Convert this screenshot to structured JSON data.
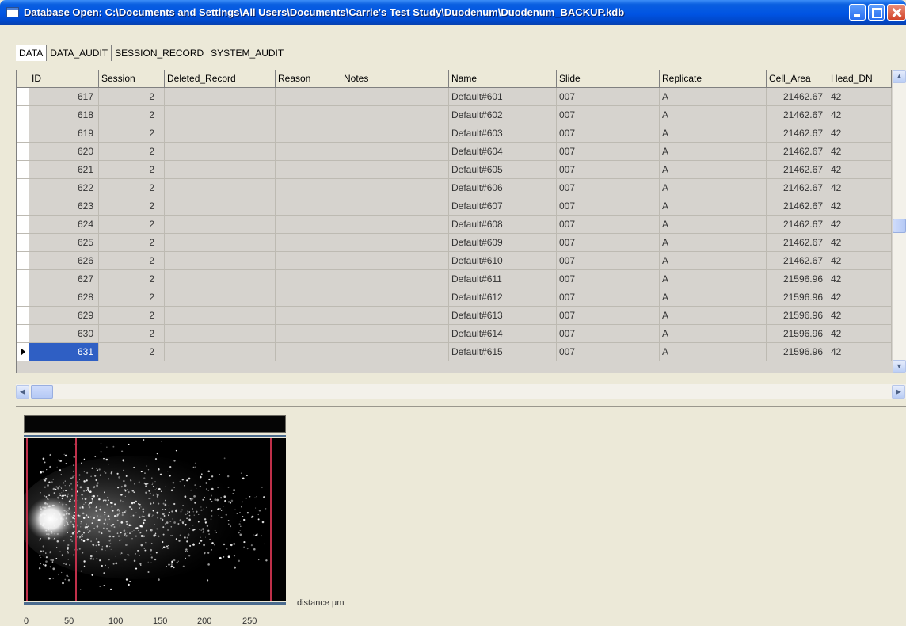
{
  "window": {
    "title": "Database Open: C:\\Documents and Settings\\All Users\\Documents\\Carrie's Test Study\\Duodenum\\Duodenum_BACKUP.kdb"
  },
  "tabs": [
    "DATA",
    "DATA_AUDIT",
    "SESSION_RECORD",
    "SYSTEM_AUDIT"
  ],
  "grid": {
    "columns": [
      "ID",
      "Session",
      "Deleted_Record",
      "Reason",
      "Notes",
      "Name",
      "Slide",
      "Replicate",
      "Cell_Area",
      "Head_DN"
    ],
    "rows": [
      {
        "id": "617",
        "session": "2",
        "name": "Default#601",
        "slide": "007",
        "replicate": "A",
        "cell_area": "21462.67",
        "head_dn": "42"
      },
      {
        "id": "618",
        "session": "2",
        "name": "Default#602",
        "slide": "007",
        "replicate": "A",
        "cell_area": "21462.67",
        "head_dn": "42"
      },
      {
        "id": "619",
        "session": "2",
        "name": "Default#603",
        "slide": "007",
        "replicate": "A",
        "cell_area": "21462.67",
        "head_dn": "42"
      },
      {
        "id": "620",
        "session": "2",
        "name": "Default#604",
        "slide": "007",
        "replicate": "A",
        "cell_area": "21462.67",
        "head_dn": "42"
      },
      {
        "id": "621",
        "session": "2",
        "name": "Default#605",
        "slide": "007",
        "replicate": "A",
        "cell_area": "21462.67",
        "head_dn": "42"
      },
      {
        "id": "622",
        "session": "2",
        "name": "Default#606",
        "slide": "007",
        "replicate": "A",
        "cell_area": "21462.67",
        "head_dn": "42"
      },
      {
        "id": "623",
        "session": "2",
        "name": "Default#607",
        "slide": "007",
        "replicate": "A",
        "cell_area": "21462.67",
        "head_dn": "42"
      },
      {
        "id": "624",
        "session": "2",
        "name": "Default#608",
        "slide": "007",
        "replicate": "A",
        "cell_area": "21462.67",
        "head_dn": "42"
      },
      {
        "id": "625",
        "session": "2",
        "name": "Default#609",
        "slide": "007",
        "replicate": "A",
        "cell_area": "21462.67",
        "head_dn": "42"
      },
      {
        "id": "626",
        "session": "2",
        "name": "Default#610",
        "slide": "007",
        "replicate": "A",
        "cell_area": "21462.67",
        "head_dn": "42"
      },
      {
        "id": "627",
        "session": "2",
        "name": "Default#611",
        "slide": "007",
        "replicate": "A",
        "cell_area": "21596.96",
        "head_dn": "42"
      },
      {
        "id": "628",
        "session": "2",
        "name": "Default#612",
        "slide": "007",
        "replicate": "A",
        "cell_area": "21596.96",
        "head_dn": "42"
      },
      {
        "id": "629",
        "session": "2",
        "name": "Default#613",
        "slide": "007",
        "replicate": "A",
        "cell_area": "21596.96",
        "head_dn": "42"
      },
      {
        "id": "630",
        "session": "2",
        "name": "Default#614",
        "slide": "007",
        "replicate": "A",
        "cell_area": "21596.96",
        "head_dn": "42"
      },
      {
        "id": "631",
        "session": "2",
        "name": "Default#615",
        "slide": "007",
        "replicate": "A",
        "cell_area": "21596.96",
        "head_dn": "42"
      }
    ],
    "selected_id": "631"
  },
  "image_panel": {
    "axis_title": "distance µm",
    "ticks": [
      "0",
      "50",
      "100",
      "150",
      "200",
      "250"
    ],
    "colors": {
      "markers": "#c0304a",
      "axis": "#4b6b8e"
    }
  }
}
